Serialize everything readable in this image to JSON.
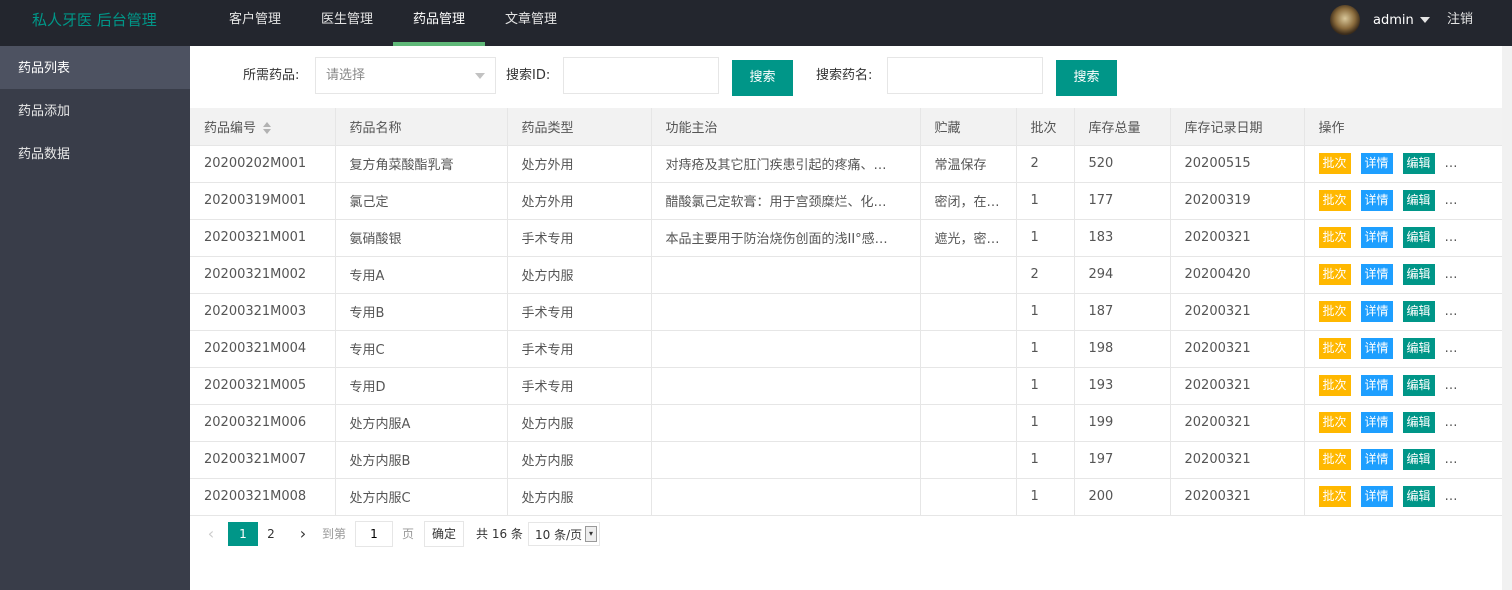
{
  "header": {
    "logo": "私人牙医 后台管理",
    "nav": [
      "客户管理",
      "医生管理",
      "药品管理",
      "文章管理"
    ],
    "active_nav": "药品管理",
    "user": "admin",
    "logout": "注销"
  },
  "sidebar": {
    "items": [
      "药品列表",
      "药品添加",
      "药品数据"
    ]
  },
  "search": {
    "drug_label": "所需药品:",
    "drug_placeholder": "请选择",
    "id_label": "搜索ID:",
    "id_value": "",
    "name_label": "搜索药名:",
    "name_value": "",
    "button": "搜索"
  },
  "table": {
    "columns": [
      "药品编号",
      "药品名称",
      "药品类型",
      "功能主治",
      "贮藏",
      "批次",
      "库存总量",
      "库存记录日期",
      "操作"
    ],
    "rows": [
      [
        "20200202M001",
        "复方角菜酸酯乳膏",
        "处方外用",
        "对痔疮及其它肛门疾患引起的疼痛、…",
        "常温保存",
        "2",
        "520",
        "20200515"
      ],
      [
        "20200319M001",
        "氯己定",
        "处方外用",
        "醋酸氯己定软膏：用于宫颈糜烂、化…",
        "密闭，在…",
        "1",
        "177",
        "20200319"
      ],
      [
        "20200321M001",
        "氨硝酸银",
        "手术专用",
        "本品主要用于防治烧伤创面的浅II°感…",
        "遮光，密…",
        "1",
        "183",
        "20200321"
      ],
      [
        "20200321M002",
        "专用A",
        "处方内服",
        "",
        "",
        "2",
        "294",
        "20200420"
      ],
      [
        "20200321M003",
        "专用B",
        "手术专用",
        "",
        "",
        "1",
        "187",
        "20200321"
      ],
      [
        "20200321M004",
        "专用C",
        "手术专用",
        "",
        "",
        "1",
        "198",
        "20200321"
      ],
      [
        "20200321M005",
        "专用D",
        "手术专用",
        "",
        "",
        "1",
        "193",
        "20200321"
      ],
      [
        "20200321M006",
        "处方内服A",
        "处方内服",
        "",
        "",
        "1",
        "199",
        "20200321"
      ],
      [
        "20200321M007",
        "处方内服B",
        "处方内服",
        "",
        "",
        "1",
        "197",
        "20200321"
      ],
      [
        "20200321M008",
        "处方内服C",
        "处方内服",
        "",
        "",
        "1",
        "200",
        "20200321"
      ]
    ],
    "ops": [
      "批次",
      "详情",
      "编辑"
    ],
    "ops_more": "…"
  },
  "pager": {
    "current": "1",
    "page2": "2",
    "goto_label": "到第",
    "goto_value": "1",
    "page_label": "页",
    "ok": "确定",
    "total": "共 16 条",
    "page_size": "10 条/页"
  },
  "icons": {
    "prev": "chevron-left-icon",
    "next": "chevron-right-icon",
    "sort": "sort-icon",
    "caret": "caret-down-icon"
  },
  "colors": {
    "header_bg": "#23262e",
    "sidebar_bg": "#393d49",
    "accent": "#009688",
    "active_underline": "#5fb878",
    "op_orange": "#ffb800",
    "op_blue": "#1e9fff",
    "op_green": "#009688"
  }
}
